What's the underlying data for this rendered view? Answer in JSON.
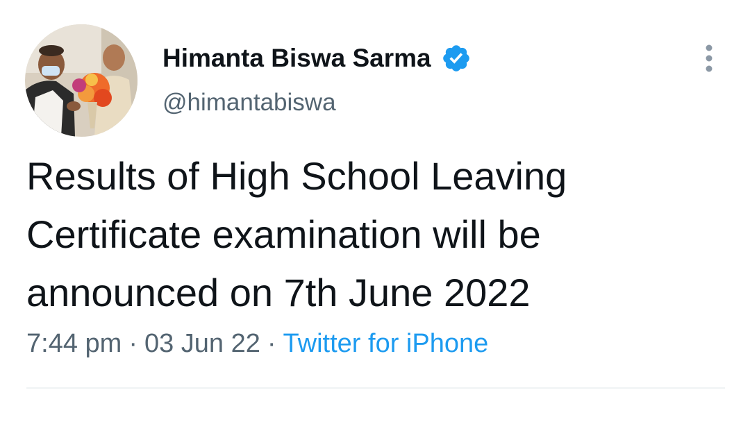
{
  "author": {
    "display_name": "Himanta Biswa Sarma",
    "handle": "@himantabiswa",
    "verified": true,
    "verified_icon": "verified-badge-icon",
    "avatar_icon": "profile-photo"
  },
  "tweet": {
    "text": "Results of High School Leaving\nCertificate examination will be\nannounced  on 7th June 2022"
  },
  "meta": {
    "time": "7:44 pm",
    "separator": "·",
    "date": "03 Jun 22",
    "source": "Twitter for iPhone"
  },
  "more_menu_icon": "more-vertical-icon",
  "colors": {
    "text": "#0f1419",
    "secondary": "#536471",
    "accent": "#1d9bf0",
    "divider": "#eff3f4"
  }
}
